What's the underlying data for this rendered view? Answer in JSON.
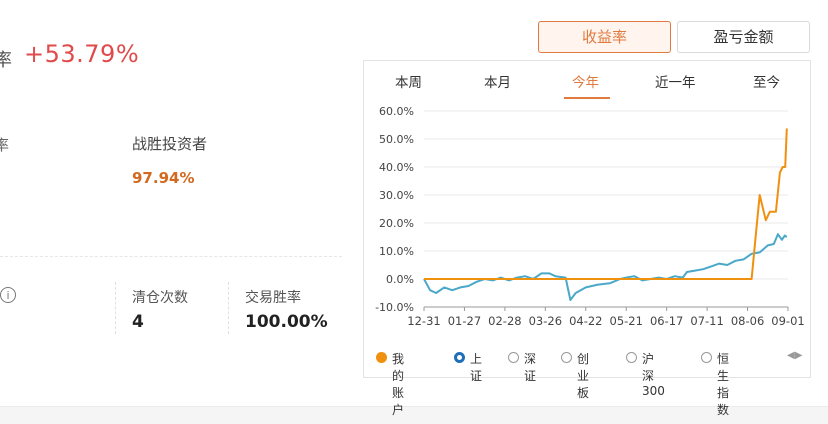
{
  "summary": {
    "cut_label": "率",
    "total_return": "+53.79%",
    "cut_label2": "率",
    "beat_label": "战胜投资者",
    "beat_value": "97.94%",
    "info_icon": "i",
    "stats": [
      {
        "label": "清仓次数",
        "value": "4"
      },
      {
        "label": "交易胜率",
        "value": "100.00%"
      }
    ]
  },
  "toggle": {
    "return_rate": "收益率",
    "profit_amount": "盈亏金额"
  },
  "tabs": [
    "本周",
    "本月",
    "今年",
    "近一年",
    "至今"
  ],
  "active_tab_index": 2,
  "legend": [
    {
      "label": "我的账户",
      "icon": "filled-dot-icon"
    },
    {
      "label": "上证",
      "icon": "ring-dot-icon"
    },
    {
      "label": "深证",
      "icon": "empty-dot-icon"
    },
    {
      "label": "创业板",
      "icon": "empty-dot-icon"
    },
    {
      "label": "沪深300",
      "icon": "empty-dot-icon"
    },
    {
      "label": "恒生指数",
      "icon": "empty-dot-icon"
    }
  ],
  "legend_arrows": "◀▶",
  "colors": {
    "accent": "#e07a3e",
    "positive": "#e04a4a",
    "account_line": "#f0900f",
    "index_line": "#4aa8c8",
    "active_border": "#e07a3e"
  },
  "chart_data": {
    "type": "line",
    "x_ticks": [
      "12-31",
      "01-27",
      "02-28",
      "03-26",
      "04-22",
      "05-21",
      "06-17",
      "07-11",
      "08-06",
      "09-01"
    ],
    "y_ticks": [
      "60.0%",
      "50.0%",
      "40.0%",
      "30.0%",
      "20.0%",
      "10.0%",
      "0.0%",
      "-10.0%"
    ],
    "ylim": [
      -10,
      60
    ],
    "grid": true,
    "x_range": [
      0,
      9
    ],
    "series": [
      {
        "name": "我的账户",
        "color": "#f0900f",
        "points": [
          [
            0,
            0
          ],
          [
            8.1,
            0
          ],
          [
            8.2,
            15
          ],
          [
            8.3,
            30
          ],
          [
            8.45,
            21
          ],
          [
            8.55,
            24
          ],
          [
            8.7,
            24
          ],
          [
            8.8,
            38
          ],
          [
            8.87,
            40
          ],
          [
            8.93,
            40
          ],
          [
            8.97,
            53.8
          ]
        ]
      },
      {
        "name": "上证",
        "color": "#4aa8c8",
        "points": [
          [
            0,
            0
          ],
          [
            0.15,
            -4
          ],
          [
            0.3,
            -5
          ],
          [
            0.5,
            -3
          ],
          [
            0.7,
            -4
          ],
          [
            0.9,
            -3
          ],
          [
            1.1,
            -2.5
          ],
          [
            1.3,
            -1
          ],
          [
            1.5,
            0
          ],
          [
            1.7,
            -0.5
          ],
          [
            1.9,
            0.5
          ],
          [
            2.1,
            -0.5
          ],
          [
            2.3,
            0.5
          ],
          [
            2.5,
            1
          ],
          [
            2.7,
            0
          ],
          [
            2.9,
            2
          ],
          [
            3.1,
            2
          ],
          [
            3.25,
            1
          ],
          [
            3.5,
            0.5
          ],
          [
            3.62,
            -7.5
          ],
          [
            3.75,
            -5
          ],
          [
            4.0,
            -3
          ],
          [
            4.3,
            -2
          ],
          [
            4.6,
            -1.5
          ],
          [
            4.85,
            0
          ],
          [
            5.0,
            0.5
          ],
          [
            5.2,
            1
          ],
          [
            5.4,
            -0.5
          ],
          [
            5.6,
            0
          ],
          [
            5.8,
            0.5
          ],
          [
            6.0,
            0
          ],
          [
            6.2,
            1
          ],
          [
            6.4,
            0.5
          ],
          [
            6.5,
            2.5
          ],
          [
            6.7,
            3
          ],
          [
            6.9,
            3.5
          ],
          [
            7.1,
            4.5
          ],
          [
            7.3,
            5.5
          ],
          [
            7.5,
            5
          ],
          [
            7.7,
            6.5
          ],
          [
            7.9,
            7
          ],
          [
            8.1,
            9
          ],
          [
            8.3,
            9.5
          ],
          [
            8.5,
            12
          ],
          [
            8.65,
            12.5
          ],
          [
            8.75,
            16
          ],
          [
            8.85,
            14
          ],
          [
            8.92,
            15.5
          ],
          [
            8.97,
            15
          ]
        ]
      }
    ]
  }
}
